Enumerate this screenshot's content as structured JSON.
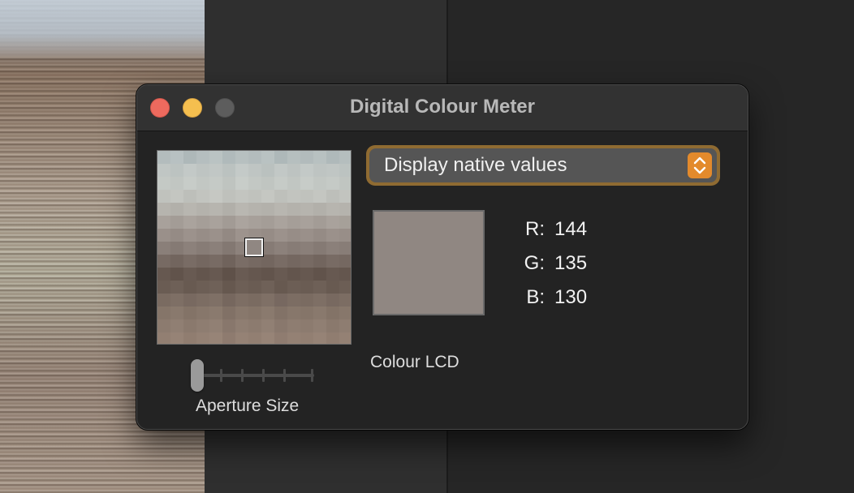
{
  "window": {
    "title": "Digital Colour Meter"
  },
  "dropdown": {
    "selected": "Display native values"
  },
  "colour": {
    "swatch_hex": "#908782",
    "r_label": "R:",
    "r_value": "144",
    "g_label": "G:",
    "g_value": "135",
    "b_label": "B:",
    "b_value": "130"
  },
  "display": {
    "name": "Colour LCD"
  },
  "aperture": {
    "label": "Aperture Size",
    "level": 0
  },
  "colors": {
    "accent": "#e38a2c",
    "close": "#ed6a5e",
    "minimize": "#f5bf4f",
    "zoom_disabled": "#5d5d5d"
  }
}
